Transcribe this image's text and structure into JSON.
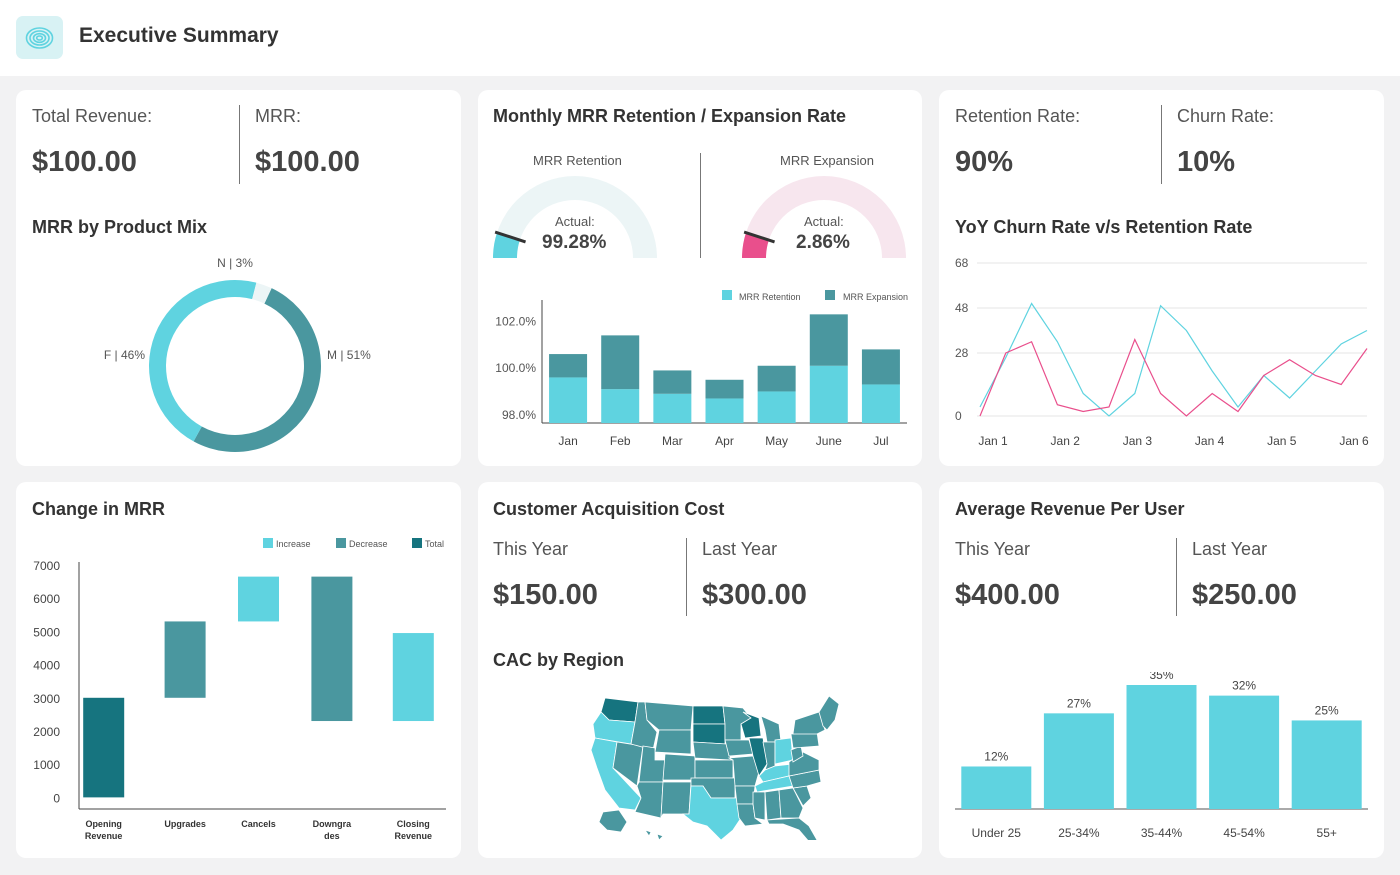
{
  "header": {
    "title": "Executive Summary",
    "logo_icon": "spiral-logo-icon"
  },
  "revenue_card": {
    "total_revenue_label": "Total Revenue:",
    "total_revenue_value": "$100.00",
    "mrr_label": "MRR:",
    "mrr_value": "$100.00",
    "product_mix_title": "MRR by Product Mix"
  },
  "retention_card": {
    "title": "Monthly MRR Retention / Expansion Rate",
    "gauge_retention_label": "MRR Retention",
    "gauge_retention_actual_label": "Actual:",
    "gauge_retention_value": "99.28%",
    "gauge_expansion_label": "MRR Expansion",
    "gauge_expansion_actual_label": "Actual:",
    "gauge_expansion_value": "2.86%"
  },
  "churn_card": {
    "retention_rate_label": "Retention Rate:",
    "retention_rate_value": "90%",
    "churn_rate_label": "Churn Rate:",
    "churn_rate_value": "10%",
    "yoy_title": "YoY Churn Rate v/s Retention Rate"
  },
  "change_card": {
    "title": "Change in MRR"
  },
  "cac_card": {
    "title": "Customer Acquisition Cost",
    "this_year_label": "This Year",
    "this_year_value": "$150.00",
    "last_year_label": "Last Year",
    "last_year_value": "$300.00",
    "region_title": "CAC by Region"
  },
  "arpu_card": {
    "title": "Average Revenue Per User",
    "this_year_label": "This Year",
    "this_year_value": "$400.00",
    "last_year_label": "Last Year",
    "last_year_value": "$250.00"
  },
  "colors": {
    "light": "#5fd3e0",
    "mid": "#4a979f",
    "dark": "#16747f",
    "pink": "#e94f8c",
    "gauge_bg_teal": "#ecf5f6",
    "gauge_bg_pink": "#f7e6ee"
  },
  "chart_data": [
    {
      "id": "product-mix",
      "type": "pie",
      "labels": [
        "M | 51%",
        "F | 46%",
        "N | 3%"
      ],
      "values": [
        51,
        46,
        3
      ]
    },
    {
      "id": "gauges",
      "type": "gauge",
      "gauges": [
        {
          "name": "MRR Retention",
          "value": 99.28,
          "fill_fraction": 0.1
        },
        {
          "name": "MRR Expansion",
          "value": 2.86,
          "fill_fraction": 0.1
        }
      ]
    },
    {
      "id": "retention-expansion",
      "type": "bar",
      "stacked": true,
      "categories": [
        "Jan",
        "Feb",
        "Mar",
        "Apr",
        "May",
        "June",
        "Jul"
      ],
      "series": [
        {
          "name": "MRR Retention",
          "values": [
            99.6,
            99.1,
            98.9,
            98.7,
            99.0,
            100.1,
            99.3
          ]
        },
        {
          "name": "MRR Expansion",
          "values": [
            1.0,
            2.3,
            1.0,
            0.8,
            1.1,
            2.2,
            1.5
          ]
        }
      ],
      "ytick_labels": [
        "102.0%",
        "100.0%",
        "98.0%"
      ],
      "yticks": [
        102,
        100,
        98
      ],
      "ylim": [
        97.65,
        102.7
      ],
      "legend": "top-right"
    },
    {
      "id": "yoy-churn",
      "type": "line",
      "categories": [
        "Jan 1",
        "Jan 2",
        "Jan 3",
        "Jan 4",
        "Jan 5",
        "Jan 6"
      ],
      "x": [
        1,
        1.35,
        1.7,
        2.05,
        2.4,
        2.75,
        3.1,
        3.45,
        3.8,
        4.15,
        4.5,
        4.85,
        5.2,
        5.55,
        5.9,
        6.25
      ],
      "series": [
        {
          "name": "",
          "color": "#5fd3e0",
          "values": [
            4,
            26,
            50,
            33,
            10,
            0,
            10,
            49,
            38,
            20,
            4,
            18,
            8,
            20,
            32,
            38
          ]
        },
        {
          "name": "",
          "color": "#e94f8c",
          "values": [
            0,
            28,
            33,
            5,
            2,
            4,
            34,
            10,
            0,
            10,
            2,
            18,
            25,
            18,
            14,
            30
          ]
        }
      ],
      "yticks": [
        0,
        28,
        48,
        68
      ],
      "ylim": [
        0,
        68
      ]
    },
    {
      "id": "change-in-mrr",
      "type": "bar",
      "subtype": "waterfall",
      "categories": [
        "Opening Revenue",
        "Upgrades",
        "Cancels",
        "Downgrades",
        "Closing Revenue"
      ],
      "category_lines": [
        [
          "Opening",
          "Revenue"
        ],
        [
          "Upgrades"
        ],
        [
          "Cancels"
        ],
        [
          "Downgra",
          "des"
        ],
        [
          "Closing",
          "Revenue"
        ]
      ],
      "bars": [
        {
          "start": 0,
          "end": 3000,
          "kind": "Total"
        },
        {
          "start": 3000,
          "end": 5300,
          "kind": "Decrease"
        },
        {
          "start": 5300,
          "end": 6650,
          "kind": "Increase"
        },
        {
          "start": 2300,
          "end": 6650,
          "kind": "Decrease"
        },
        {
          "start": 2300,
          "end": 4950,
          "kind": "Increase"
        }
      ],
      "legend": [
        "Increase",
        "Decrease",
        "Total"
      ],
      "yticks": [
        0,
        1000,
        2000,
        3000,
        4000,
        5000,
        6000,
        7000
      ],
      "ylim": [
        -350,
        7000
      ]
    },
    {
      "id": "arpu-age",
      "type": "bar",
      "categories": [
        "Under 25",
        "25-34%",
        "35-44%",
        "45-54%",
        "55+"
      ],
      "values": [
        12,
        27,
        35,
        32,
        25
      ],
      "value_labels": [
        "12%",
        "27%",
        "35%",
        "32%",
        "25%"
      ],
      "ylim": [
        0,
        35
      ]
    }
  ],
  "map": {
    "type": "choropleth-us",
    "states": [
      {
        "id": "WA",
        "c": "dark"
      },
      {
        "id": "OR",
        "c": "light"
      },
      {
        "id": "CA",
        "c": "light"
      },
      {
        "id": "NV",
        "c": "mid"
      },
      {
        "id": "ID",
        "c": "mid"
      },
      {
        "id": "MT",
        "c": "mid"
      },
      {
        "id": "WY",
        "c": "mid"
      },
      {
        "id": "UT",
        "c": "mid"
      },
      {
        "id": "AZ",
        "c": "mid"
      },
      {
        "id": "CO",
        "c": "mid"
      },
      {
        "id": "NM",
        "c": "mid"
      },
      {
        "id": "ND",
        "c": "dark"
      },
      {
        "id": "SD",
        "c": "dark"
      },
      {
        "id": "NE",
        "c": "mid"
      },
      {
        "id": "KS",
        "c": "mid"
      },
      {
        "id": "OK",
        "c": "mid"
      },
      {
        "id": "TX",
        "c": "light"
      },
      {
        "id": "MN",
        "c": "mid"
      },
      {
        "id": "IA",
        "c": "mid"
      },
      {
        "id": "MO",
        "c": "mid"
      },
      {
        "id": "AR",
        "c": "mid"
      },
      {
        "id": "LA",
        "c": "mid"
      },
      {
        "id": "WI",
        "c": "dark"
      },
      {
        "id": "IL",
        "c": "dark"
      },
      {
        "id": "MI",
        "c": "mid"
      },
      {
        "id": "IN",
        "c": "mid"
      },
      {
        "id": "OH",
        "c": "light"
      },
      {
        "id": "KY",
        "c": "light"
      },
      {
        "id": "TN",
        "c": "light"
      },
      {
        "id": "MS",
        "c": "mid"
      },
      {
        "id": "AL",
        "c": "mid"
      },
      {
        "id": "GA",
        "c": "mid"
      },
      {
        "id": "FL",
        "c": "mid"
      },
      {
        "id": "SC",
        "c": "mid"
      },
      {
        "id": "NC",
        "c": "mid"
      },
      {
        "id": "VA",
        "c": "mid"
      },
      {
        "id": "WV",
        "c": "mid"
      },
      {
        "id": "PA",
        "c": "mid"
      },
      {
        "id": "NY",
        "c": "mid"
      },
      {
        "id": "NE2",
        "c": "mid"
      },
      {
        "id": "AK",
        "c": "mid"
      },
      {
        "id": "HI",
        "c": "mid"
      }
    ]
  }
}
